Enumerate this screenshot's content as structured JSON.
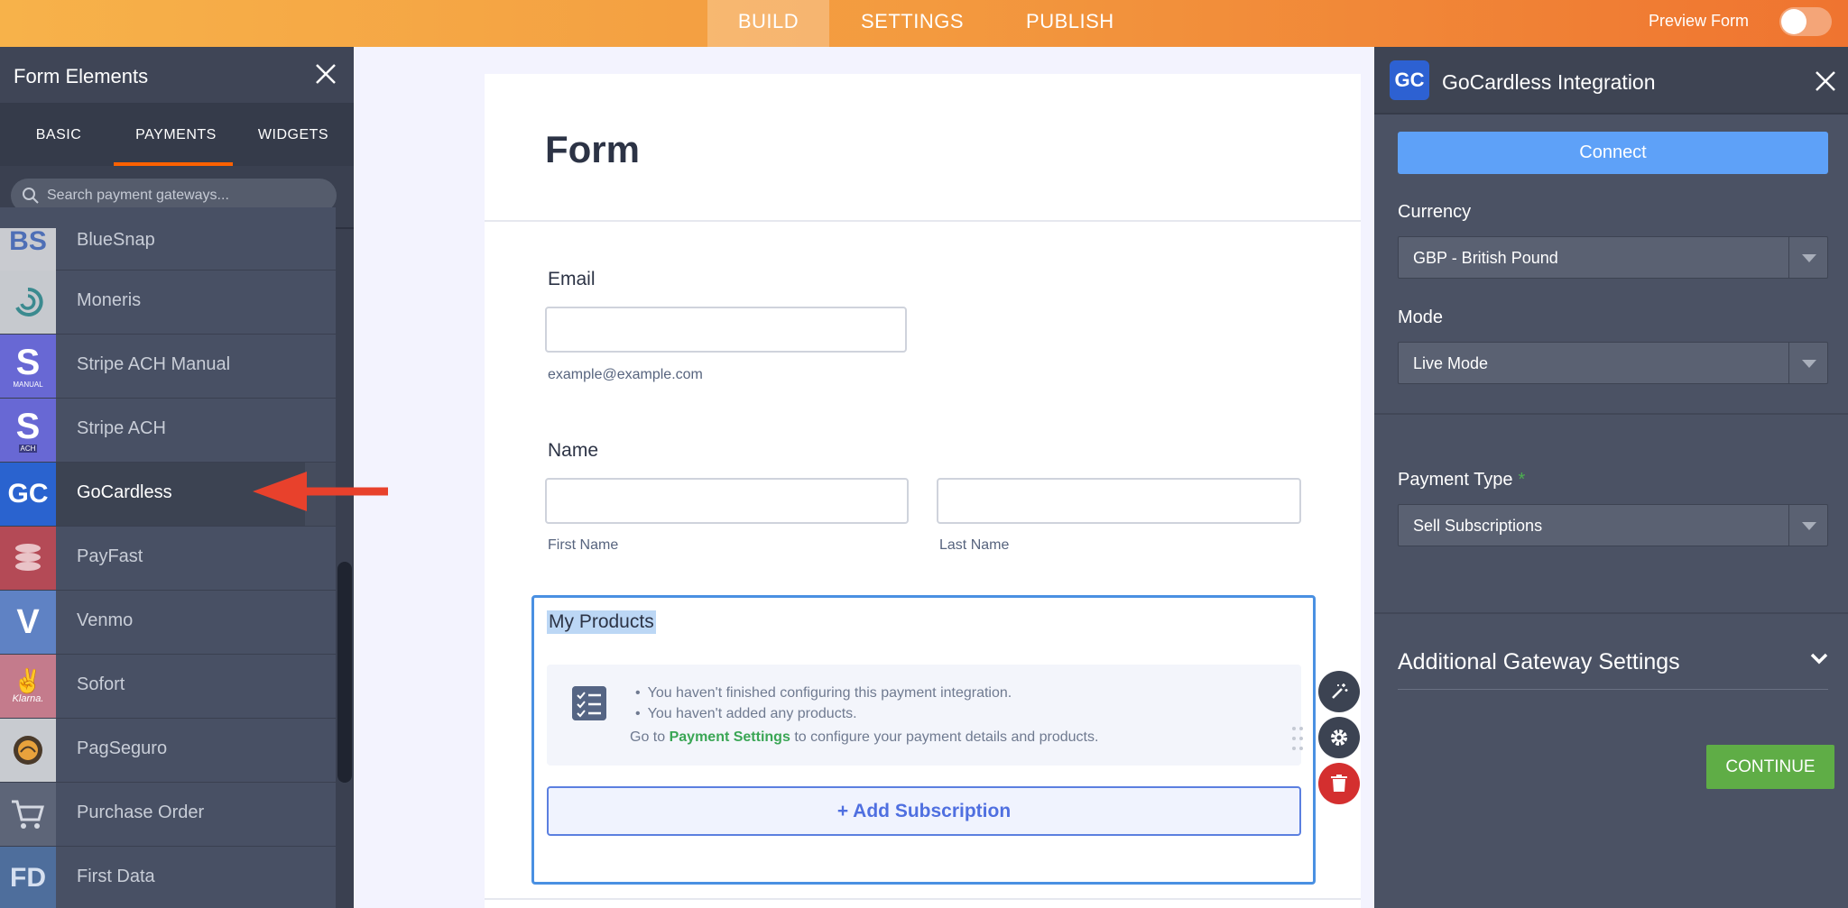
{
  "topbar": {
    "tabs": [
      "BUILD",
      "SETTINGS",
      "PUBLISH"
    ],
    "preview_label": "Preview Form"
  },
  "left_panel": {
    "title": "Form Elements",
    "tabs": [
      "BASIC",
      "PAYMENTS",
      "WIDGETS"
    ],
    "active_tab": "PAYMENTS",
    "search_placeholder": "Search payment gateways...",
    "items": [
      {
        "label": "BlueSnap",
        "logo_text": "BS",
        "logo_bg": "#c9cbd0"
      },
      {
        "label": "Moneris",
        "logo_text": "",
        "logo_bg": "#c6c9ce"
      },
      {
        "label": "Stripe ACH Manual",
        "logo_text": "S",
        "logo_bg": "#6868d4"
      },
      {
        "label": "Stripe ACH",
        "logo_text": "S",
        "logo_bg": "#6868d4"
      },
      {
        "label": "GoCardless",
        "logo_text": "GC",
        "logo_bg": "#2a63cf"
      },
      {
        "label": "PayFast",
        "logo_text": "",
        "logo_bg": "#b44a56"
      },
      {
        "label": "Venmo",
        "logo_text": "V",
        "logo_bg": "#5f82c4"
      },
      {
        "label": "Sofort",
        "logo_text": "",
        "logo_bg": "#c47b8c"
      },
      {
        "label": "PagSeguro",
        "logo_text": "",
        "logo_bg": "#c8cbd0"
      },
      {
        "label": "Purchase Order",
        "logo_text": "",
        "logo_bg": "#5d6578"
      },
      {
        "label": "First Data",
        "logo_text": "FD",
        "logo_bg": "#4e6e9c"
      }
    ],
    "selected_item": "GoCardless",
    "badge_ach": "ACH",
    "badge_manual": "MANUAL",
    "badge_klarna": "Klarna."
  },
  "form": {
    "title": "Form",
    "email_label": "Email",
    "email_sublabel": "example@example.com",
    "name_label": "Name",
    "first_name_sublabel": "First Name",
    "last_name_sublabel": "Last Name",
    "products_title": "My Products",
    "warnings": [
      "You haven't finished configuring this payment integration.",
      "You haven't added any products."
    ],
    "goto_prefix": "Go to",
    "goto_link": "Payment Settings",
    "goto_suffix": "to configure your payment details and products.",
    "add_subscription": "+ Add Subscription"
  },
  "right_panel": {
    "badge": "GC",
    "title": "GoCardless Integration",
    "connect_label": "Connect",
    "currency_label": "Currency",
    "currency_value": "GBP - British Pound",
    "mode_label": "Mode",
    "mode_value": "Live Mode",
    "payment_type_label": "Payment Type",
    "payment_type_required": "*",
    "payment_type_value": "Sell Subscriptions",
    "additional_settings_label": "Additional Gateway Settings",
    "continue_label": "CONTINUE"
  },
  "colors": {
    "accent_orange": "#ef7430",
    "connect_blue": "#5ea1f8",
    "continue_green": "#5fad46",
    "link_green": "#3aa655",
    "arrow_red": "#e8412c"
  }
}
